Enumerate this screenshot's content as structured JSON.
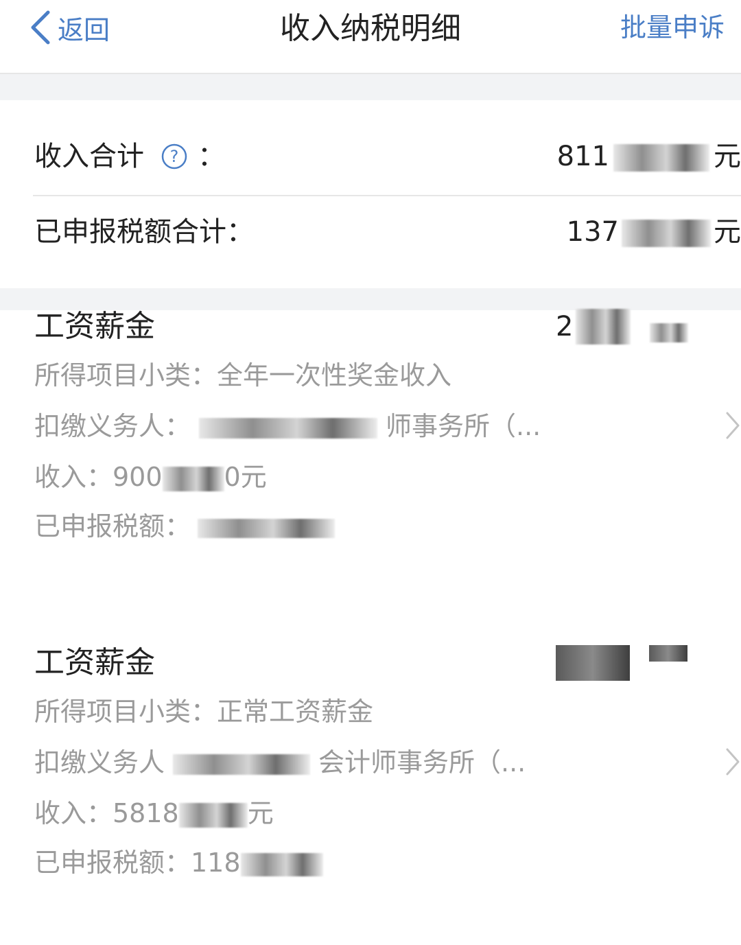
{
  "header": {
    "back_label": "返回",
    "title": "收入纳税明细",
    "batch_label": "批量申诉"
  },
  "summary": {
    "income_label": "收入合计",
    "income_colon": "：",
    "income_value": "811",
    "tax_label": "已申报税额合计：",
    "tax_value": "137",
    "unit": "元"
  },
  "records": [
    {
      "category": "工资薪金",
      "amount_partial": "2",
      "subtype": "所得项目小类：全年一次性奖金收入",
      "withholder_label": "扣缴义务人：",
      "withholder_tail": "师事务所（...",
      "income_prefix": "收入：900",
      "income_suffix": "0元",
      "tax_label": "已申报税额："
    },
    {
      "category": "工资薪金",
      "amount_partial": "",
      "subtype": "所得项目小类：正常工资薪金",
      "withholder_label": "扣缴义务人",
      "withholder_tail": "会计师事务所（...",
      "income_prefix": "收入：5818",
      "income_suffix": "元",
      "tax_label": "已申报税额：118"
    }
  ],
  "colors": {
    "accent": "#4a7ec6",
    "primary_text": "#222222",
    "secondary_text": "#9a9a9a",
    "separator": "#f2f3f5"
  }
}
